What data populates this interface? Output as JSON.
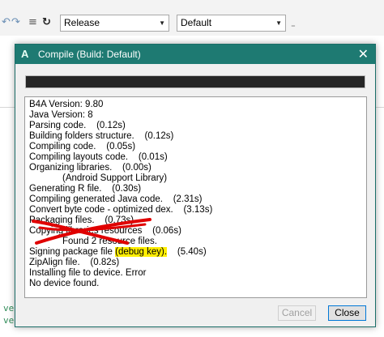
{
  "toolbar": {
    "build_config": "Release",
    "conditional_symbols": "Default",
    "more": "₌"
  },
  "dialog": {
    "title": "Compile (Build: Default)",
    "icon_letter": "A",
    "close_glyph": "✕",
    "progress_fraction": 1.0,
    "log": [
      {
        "text": "B4A Version: 9.80"
      },
      {
        "text": "Java Version: 8"
      },
      {
        "text": "Parsing code.    (0.12s)"
      },
      {
        "text": "Building folders structure.    (0.12s)"
      },
      {
        "text": "Compiling code.    (0.05s)"
      },
      {
        "text": "Compiling layouts code.    (0.01s)"
      },
      {
        "text": "Organizing libraries.    (0.00s)"
      },
      {
        "text": "(Android Support Library)",
        "indent": true
      },
      {
        "text": "Generating R file.    (0.30s)"
      },
      {
        "text": "Compiling generated Java code.    (2.31s)"
      },
      {
        "text": "Convert byte code - optimized dex.    (3.13s)"
      },
      {
        "text": "Packaging files.    (0.73s)"
      },
      {
        "text": "Copying libraries resources    (0.06s)"
      },
      {
        "text": "Found 2 resource files.",
        "indent": true
      },
      {
        "pre": "Signing package file ",
        "highlight": "(debug key).",
        "post": "    (5.40s)"
      },
      {
        "text": "ZipAlign file.    (0.82s)"
      },
      {
        "text": "Installing file to device. Error"
      },
      {
        "text": "No device found."
      }
    ],
    "buttons": {
      "cancel": "Cancel",
      "close": "Close"
    }
  },
  "background_log": {
    "line1": "ve",
    "line2": "ve"
  },
  "colors": {
    "titlebar": "#1e7a72",
    "highlight": "#ffee00",
    "scribble": "#e00000"
  }
}
